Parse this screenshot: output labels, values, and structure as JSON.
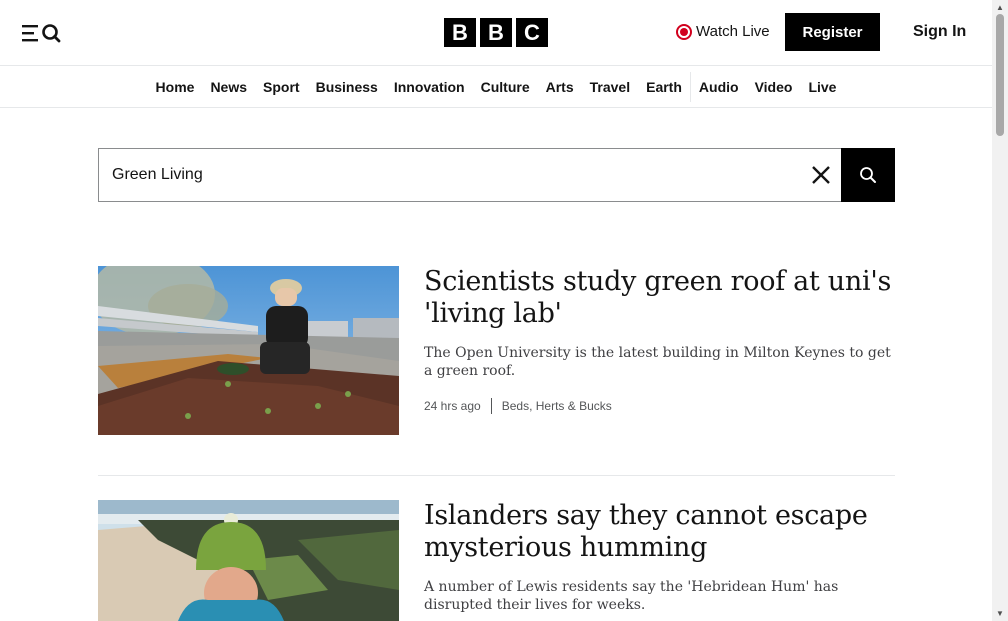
{
  "header": {
    "logo_letters": [
      "B",
      "B",
      "C"
    ],
    "watch_live": "Watch Live",
    "register": "Register",
    "sign_in": "Sign In"
  },
  "nav": {
    "items": [
      "Home",
      "News",
      "Sport",
      "Business",
      "Innovation",
      "Culture",
      "Arts",
      "Travel",
      "Earth",
      "Audio",
      "Video",
      "Live"
    ]
  },
  "search": {
    "value": "Green Living"
  },
  "articles": [
    {
      "headline": "Scientists study green roof at uni's 'living lab'",
      "summary": "The Open University is the latest building in Milton Keynes to get a green roof.",
      "time": "24 hrs ago",
      "section": "Beds, Herts & Bucks"
    },
    {
      "headline": "Islanders say they cannot escape mysterious humming",
      "summary": "A number of Lewis residents say the 'Hebridean Hum' has disrupted their lives for weeks."
    }
  ],
  "colors": {
    "brand_black": "#000000",
    "live_red": "#d1001d",
    "divider": "#e6e8ea"
  }
}
